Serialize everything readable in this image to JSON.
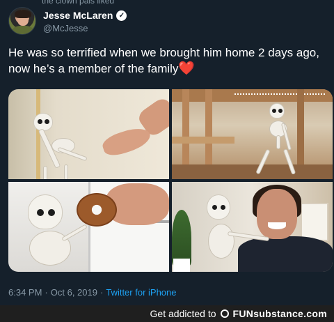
{
  "top_cut_text": "the clown pals liked",
  "author": {
    "display_name": "Jesse McLaren",
    "handle": "@McJesse",
    "verified_icon": "verified-badge-icon"
  },
  "tweet": {
    "text": "He was so terrified when we brought him home 2 days ago, now he’s a member of the family",
    "emoji": "❤️"
  },
  "media": {
    "count": 4,
    "photos": [
      "skeleton-hiding-corner-photo",
      "skeleton-under-loft-bed-photo",
      "skeleton-eating-donut-photo",
      "skeleton-with-man-selfie-photo"
    ]
  },
  "meta": {
    "time": "6:34 PM",
    "separator1": "·",
    "date": "Oct 6, 2019",
    "separator2": "·",
    "source": "Twitter for iPhone"
  },
  "watermark": {
    "text": "Get addicted to",
    "logo": "FUNsubstance.com"
  },
  "colors": {
    "background": "#15202b",
    "secondary_text": "#8899a6",
    "link": "#1da1f2",
    "heart": "#e0245e"
  }
}
